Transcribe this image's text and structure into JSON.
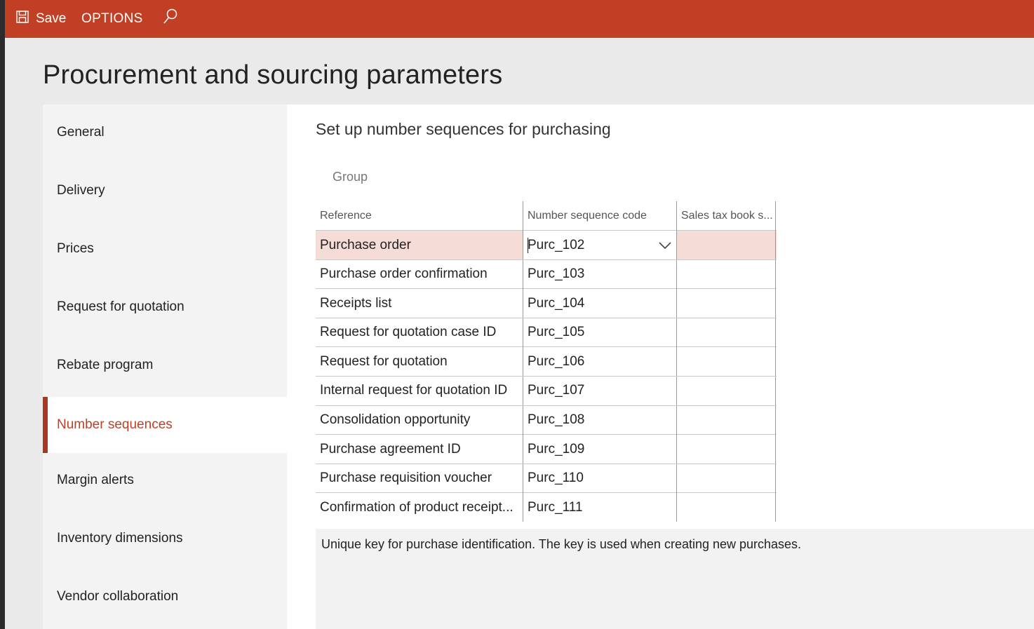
{
  "toolbar": {
    "save_label": "Save",
    "options_label": "OPTIONS",
    "accent": "#c13f24"
  },
  "page_title": "Procurement and sourcing parameters",
  "sidebar": {
    "items": [
      {
        "label": "General"
      },
      {
        "label": "Delivery"
      },
      {
        "label": "Prices"
      },
      {
        "label": "Request for quotation"
      },
      {
        "label": "Rebate program"
      },
      {
        "label": "Number sequences",
        "active": true
      },
      {
        "label": "Margin alerts"
      },
      {
        "label": "Inventory dimensions"
      },
      {
        "label": "Vendor collaboration"
      }
    ]
  },
  "main": {
    "section_title": "Set up number sequences for purchasing",
    "group_label": "Group",
    "grid": {
      "columns": [
        "Reference",
        "Number sequence code",
        "Sales tax book s..."
      ],
      "rows": [
        {
          "reference": "Purchase order",
          "code": "Purc_102",
          "sales_tax": ""
        },
        {
          "reference": "Purchase order confirmation",
          "code": "Purc_103",
          "sales_tax": ""
        },
        {
          "reference": "Receipts list",
          "code": "Purc_104",
          "sales_tax": ""
        },
        {
          "reference": "Request for quotation case ID",
          "code": "Purc_105",
          "sales_tax": ""
        },
        {
          "reference": "Request for quotation",
          "code": "Purc_106",
          "sales_tax": ""
        },
        {
          "reference": "Internal request for quotation ID",
          "code": "Purc_107",
          "sales_tax": ""
        },
        {
          "reference": "Consolidation opportunity",
          "code": "Purc_108",
          "sales_tax": ""
        },
        {
          "reference": "Purchase agreement ID",
          "code": "Purc_109",
          "sales_tax": ""
        },
        {
          "reference": "Purchase requisition voucher",
          "code": "Purc_110",
          "sales_tax": ""
        },
        {
          "reference": "Confirmation of product receipt...",
          "code": "Purc_111",
          "sales_tax": ""
        }
      ]
    },
    "help_text": "Unique key for purchase identification. The key is used when creating new purchases."
  }
}
